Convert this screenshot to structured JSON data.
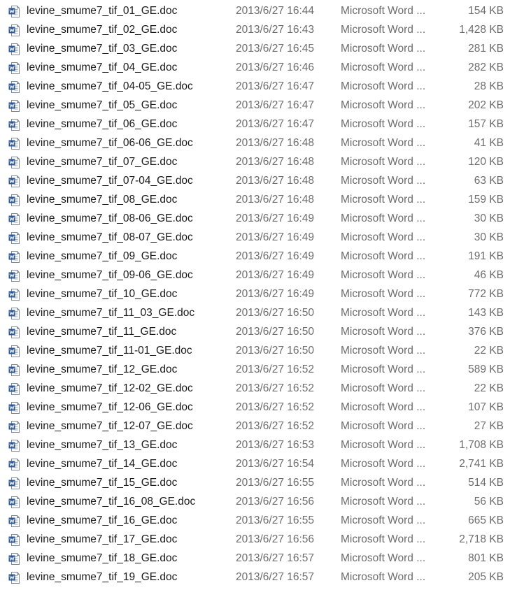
{
  "icon": "word-document-icon",
  "colors": {
    "word_blue": "#2b579a",
    "name_text": "#1a1a1a",
    "meta_text": "#6d6d6d"
  },
  "files": [
    {
      "name": "levine_smume7_tif_01_GE.doc",
      "date": "2013/6/27 16:44",
      "type": "Microsoft Word ...",
      "size": "154 KB"
    },
    {
      "name": "levine_smume7_tif_02_GE.doc",
      "date": "2013/6/27 16:43",
      "type": "Microsoft Word ...",
      "size": "1,428 KB"
    },
    {
      "name": "levine_smume7_tif_03_GE.doc",
      "date": "2013/6/27 16:45",
      "type": "Microsoft Word ...",
      "size": "281 KB"
    },
    {
      "name": "levine_smume7_tif_04_GE.doc",
      "date": "2013/6/27 16:46",
      "type": "Microsoft Word ...",
      "size": "282 KB"
    },
    {
      "name": "levine_smume7_tif_04-05_GE.doc",
      "date": "2013/6/27 16:47",
      "type": "Microsoft Word ...",
      "size": "28 KB"
    },
    {
      "name": "levine_smume7_tif_05_GE.doc",
      "date": "2013/6/27 16:47",
      "type": "Microsoft Word ...",
      "size": "202 KB"
    },
    {
      "name": "levine_smume7_tif_06_GE.doc",
      "date": "2013/6/27 16:47",
      "type": "Microsoft Word ...",
      "size": "157 KB"
    },
    {
      "name": "levine_smume7_tif_06-06_GE.doc",
      "date": "2013/6/27 16:48",
      "type": "Microsoft Word ...",
      "size": "41 KB"
    },
    {
      "name": "levine_smume7_tif_07_GE.doc",
      "date": "2013/6/27 16:48",
      "type": "Microsoft Word ...",
      "size": "120 KB"
    },
    {
      "name": "levine_smume7_tif_07-04_GE.doc",
      "date": "2013/6/27 16:48",
      "type": "Microsoft Word ...",
      "size": "63 KB"
    },
    {
      "name": "levine_smume7_tif_08_GE.doc",
      "date": "2013/6/27 16:48",
      "type": "Microsoft Word ...",
      "size": "159 KB"
    },
    {
      "name": "levine_smume7_tif_08-06_GE.doc",
      "date": "2013/6/27 16:49",
      "type": "Microsoft Word ...",
      "size": "30 KB"
    },
    {
      "name": "levine_smume7_tif_08-07_GE.doc",
      "date": "2013/6/27 16:49",
      "type": "Microsoft Word ...",
      "size": "30 KB"
    },
    {
      "name": "levine_smume7_tif_09_GE.doc",
      "date": "2013/6/27 16:49",
      "type": "Microsoft Word ...",
      "size": "191 KB"
    },
    {
      "name": "levine_smume7_tif_09-06_GE.doc",
      "date": "2013/6/27 16:49",
      "type": "Microsoft Word ...",
      "size": "46 KB"
    },
    {
      "name": "levine_smume7_tif_10_GE.doc",
      "date": "2013/6/27 16:49",
      "type": "Microsoft Word ...",
      "size": "772 KB"
    },
    {
      "name": "levine_smume7_tif_11_03_GE.doc",
      "date": "2013/6/27 16:50",
      "type": "Microsoft Word ...",
      "size": "143 KB"
    },
    {
      "name": "levine_smume7_tif_11_GE.doc",
      "date": "2013/6/27 16:50",
      "type": "Microsoft Word ...",
      "size": "376 KB"
    },
    {
      "name": "levine_smume7_tif_11-01_GE.doc",
      "date": "2013/6/27 16:50",
      "type": "Microsoft Word ...",
      "size": "22 KB"
    },
    {
      "name": "levine_smume7_tif_12_GE.doc",
      "date": "2013/6/27 16:52",
      "type": "Microsoft Word ...",
      "size": "589 KB"
    },
    {
      "name": "levine_smume7_tif_12-02_GE.doc",
      "date": "2013/6/27 16:52",
      "type": "Microsoft Word ...",
      "size": "22 KB"
    },
    {
      "name": "levine_smume7_tif_12-06_GE.doc",
      "date": "2013/6/27 16:52",
      "type": "Microsoft Word ...",
      "size": "107 KB"
    },
    {
      "name": "levine_smume7_tif_12-07_GE.doc",
      "date": "2013/6/27 16:52",
      "type": "Microsoft Word ...",
      "size": "27 KB"
    },
    {
      "name": "levine_smume7_tif_13_GE.doc",
      "date": "2013/6/27 16:53",
      "type": "Microsoft Word ...",
      "size": "1,708 KB"
    },
    {
      "name": "levine_smume7_tif_14_GE.doc",
      "date": "2013/6/27 16:54",
      "type": "Microsoft Word ...",
      "size": "2,741 KB"
    },
    {
      "name": "levine_smume7_tif_15_GE.doc",
      "date": "2013/6/27 16:55",
      "type": "Microsoft Word ...",
      "size": "514 KB"
    },
    {
      "name": "levine_smume7_tif_16_08_GE.doc",
      "date": "2013/6/27 16:56",
      "type": "Microsoft Word ...",
      "size": "56 KB"
    },
    {
      "name": "levine_smume7_tif_16_GE.doc",
      "date": "2013/6/27 16:55",
      "type": "Microsoft Word ...",
      "size": "665 KB"
    },
    {
      "name": "levine_smume7_tif_17_GE.doc",
      "date": "2013/6/27 16:56",
      "type": "Microsoft Word ...",
      "size": "2,718 KB"
    },
    {
      "name": "levine_smume7_tif_18_GE.doc",
      "date": "2013/6/27 16:57",
      "type": "Microsoft Word ...",
      "size": "801 KB"
    },
    {
      "name": "levine_smume7_tif_19_GE.doc",
      "date": "2013/6/27 16:57",
      "type": "Microsoft Word ...",
      "size": "205 KB"
    }
  ]
}
